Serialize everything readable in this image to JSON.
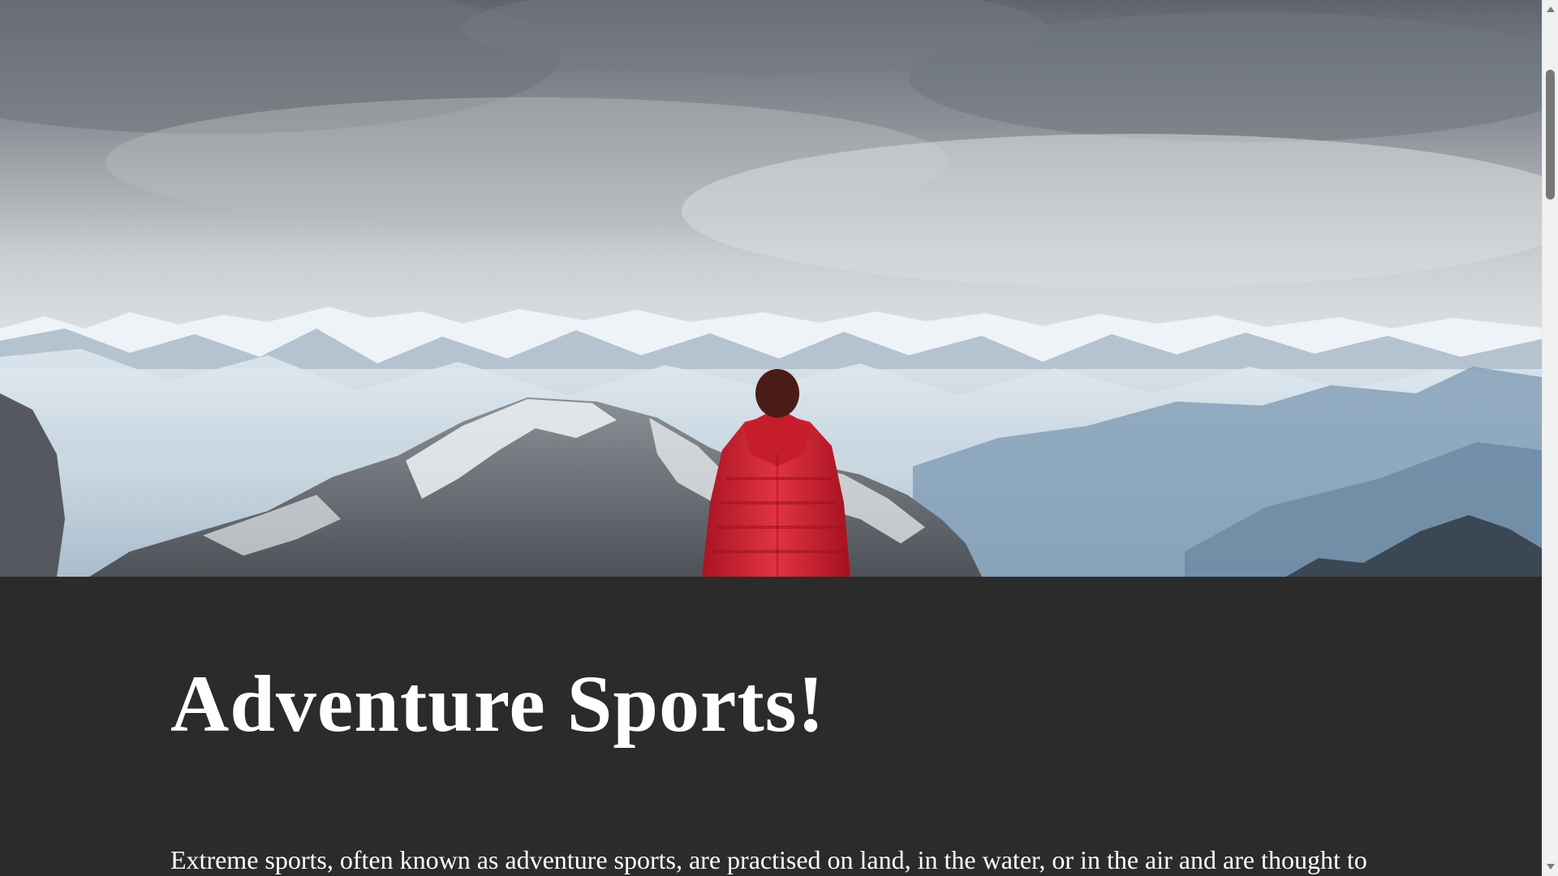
{
  "hero": {
    "image_label": "snowy-mountains-hiker-image"
  },
  "main": {
    "title": "Adventure Sports!",
    "intro": "Extreme sports, often known as adventure sports, are practised on land, in the water, or in the air and are thought to"
  },
  "colors": {
    "page_background": "#2b2b2b",
    "heading_text": "#ffffff",
    "jacket_red": "#d82634"
  },
  "scrollbar": {
    "up_icon": "scroll-up-arrow-icon",
    "down_icon": "scroll-down-arrow-icon"
  }
}
